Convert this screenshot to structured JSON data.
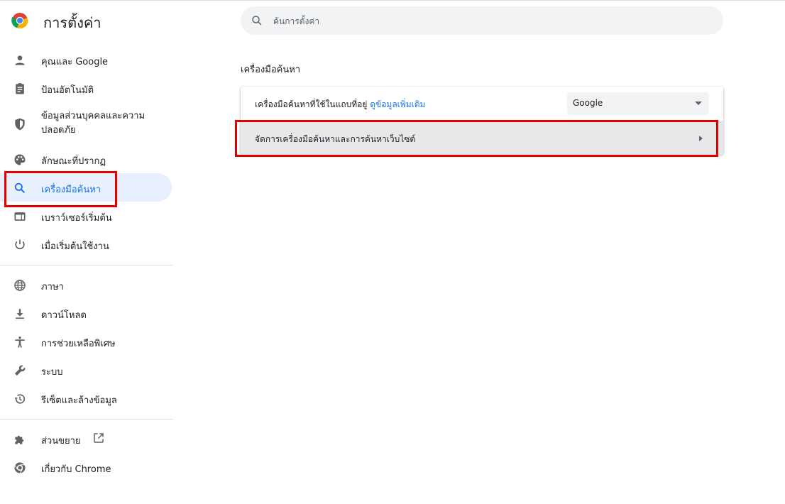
{
  "header": {
    "title": "การตั้งค่า",
    "search_placeholder": "ค้นการตั้งค่า"
  },
  "sidebar": {
    "items": [
      {
        "label": "คุณและ Google",
        "icon": "person-icon"
      },
      {
        "label": "ป้อนอัตโนมัติ",
        "icon": "clipboard-icon"
      },
      {
        "label": "ข้อมูลส่วนบุคคลและความปลอดภัย",
        "icon": "shield-icon"
      },
      {
        "label": "ลักษณะที่ปรากฏ",
        "icon": "palette-icon"
      },
      {
        "label": "เครื่องมือค้นหา",
        "icon": "search-icon",
        "active": true
      },
      {
        "label": "เบราว์เซอร์เริ่มต้น",
        "icon": "browser-window-icon"
      },
      {
        "label": "เมื่อเริ่มต้นใช้งาน",
        "icon": "power-icon"
      },
      {
        "label": "ภาษา",
        "icon": "globe-icon"
      },
      {
        "label": "ดาวน์โหลด",
        "icon": "download-icon"
      },
      {
        "label": "การช่วยเหลือพิเศษ",
        "icon": "accessibility-icon"
      },
      {
        "label": "ระบบ",
        "icon": "wrench-icon"
      },
      {
        "label": "รีเซ็ตและล้างข้อมูล",
        "icon": "restore-icon"
      },
      {
        "label": "ส่วนขยาย",
        "icon": "puzzle-icon"
      },
      {
        "label": "เกี่ยวกับ Chrome",
        "icon": "chrome-icon"
      }
    ]
  },
  "main": {
    "section_title": "เครื่องมือค้นหา",
    "search_engine_label": "เครื่องมือค้นหาที่ใช้ในแถบที่อยู่",
    "learn_more_link": "ดูข้อมูลเพิ่มเติม",
    "search_engine_value": "Google",
    "manage_label": "จัดการเครื่องมือค้นหาและการค้นหาเว็บไซต์"
  },
  "colors": {
    "accent": "#1a73e8",
    "active_bg": "#e8f0fe",
    "highlight": "#e50000"
  }
}
